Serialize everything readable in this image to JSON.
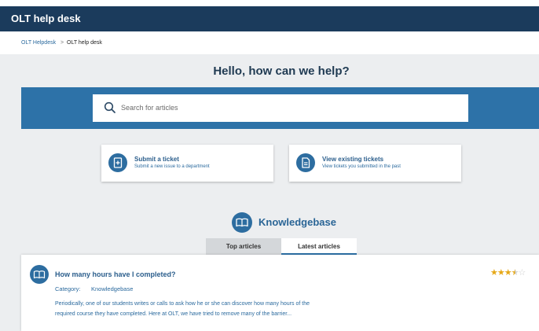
{
  "header": {
    "title": "OLT help desk"
  },
  "breadcrumb": {
    "link": "OLT Helpdesk",
    "separator": ">",
    "current": "OLT help desk"
  },
  "hero": {
    "title": "Hello, how can we help?"
  },
  "search": {
    "placeholder": "Search for articles",
    "value": ""
  },
  "cards": [
    {
      "title": "Submit a ticket",
      "description": "Submit a new issue to a department",
      "icon": "ticket-add-icon"
    },
    {
      "title": "View existing tickets",
      "description": "View tickets you submitted in the past",
      "icon": "document-icon"
    }
  ],
  "knowledgebase": {
    "title": "Knowledgebase",
    "icon": "open-book-icon",
    "tabs": [
      {
        "label": "Top articles",
        "active": false
      },
      {
        "label": "Latest articles",
        "active": true
      }
    ],
    "articles": [
      {
        "title": "How many hours have I completed?",
        "category_label": "Category:",
        "category": "Knowledgebase",
        "rating": 3.5,
        "rating_max": 5,
        "excerpt_line1": "Periodically, one of our students writes or calls to ask how he or she can discover how many hours of the",
        "excerpt_line2": "required course they have completed.  Here at OLT, we have tried to remove many of the barrier..."
      }
    ]
  },
  "colors": {
    "header_bg": "#1b3b5c",
    "accent": "#2d72a8",
    "hero_bg": "#eceef0",
    "star": "#e6a817"
  }
}
